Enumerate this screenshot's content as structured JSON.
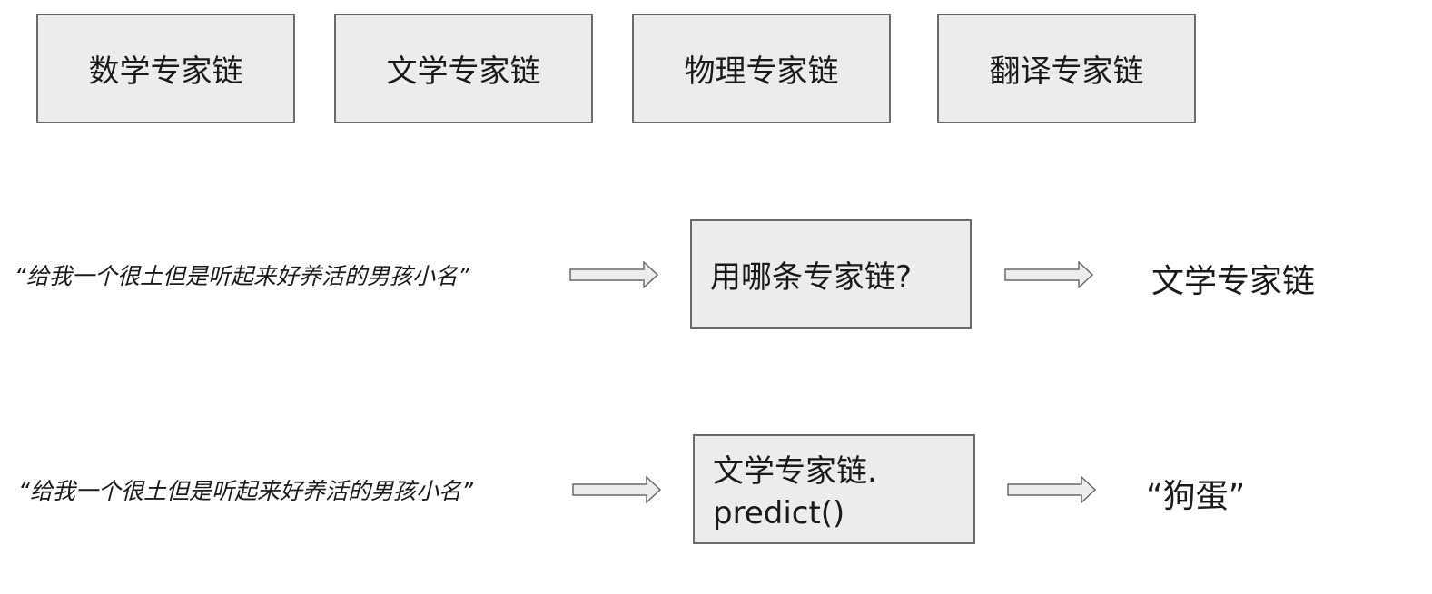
{
  "expert_chains": [
    {
      "label": "数学专家链"
    },
    {
      "label": "文学专家链"
    },
    {
      "label": "物理专家链"
    },
    {
      "label": "翻译专家链"
    }
  ],
  "routing_row": {
    "input_quote": "“给我一个很土但是听起来好养活的男孩小名”",
    "router_label": "用哪条专家链?",
    "result": "文学专家链"
  },
  "predict_row": {
    "input_quote": "“给我一个很土但是听起来好养活的男孩小名”",
    "call_line_1": "文学专家链.",
    "call_line_2": "predict()",
    "result": "“狗蛋”"
  },
  "colors": {
    "box_fill": "#ececec",
    "box_border": "#6b6b6b",
    "arrow_fill": "#ececec",
    "arrow_stroke": "#6b6b6b"
  },
  "icons": {
    "arrow": "right-arrow-icon"
  }
}
